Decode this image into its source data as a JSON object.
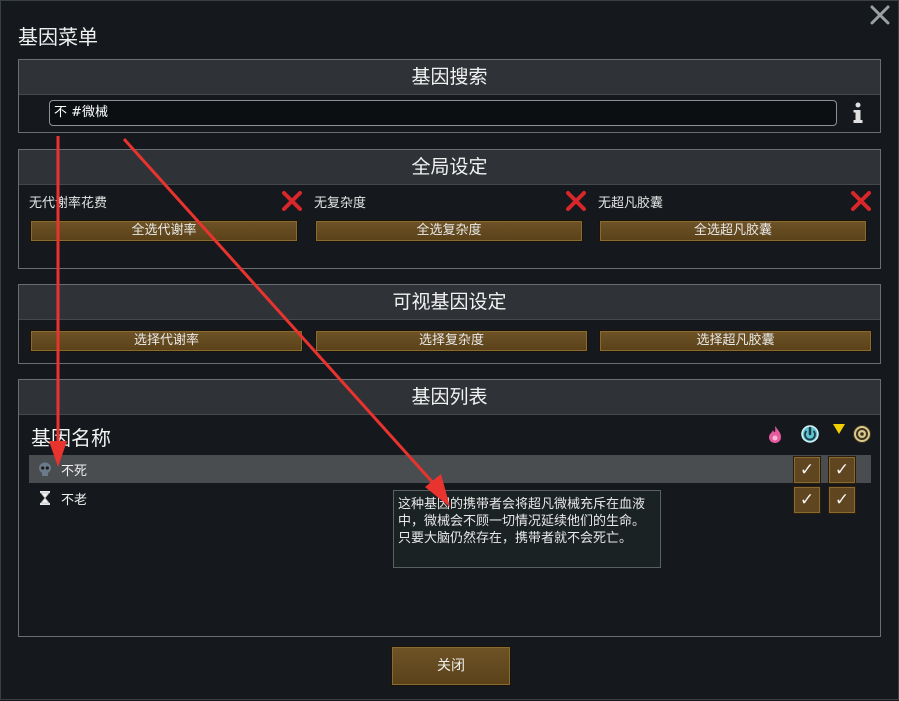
{
  "window": {
    "title": "基因菜单"
  },
  "search": {
    "header": "基因搜索",
    "value": "不 #微械"
  },
  "global": {
    "header": "全局设定",
    "options": [
      {
        "label": "无代谢率花费",
        "button": "全选代谢率"
      },
      {
        "label": "无复杂度",
        "button": "全选复杂度"
      },
      {
        "label": "无超凡胶囊",
        "button": "全选超凡胶囊"
      }
    ]
  },
  "visible": {
    "header": "可视基因设定",
    "buttons": [
      "选择代谢率",
      "选择复杂度",
      "选择超凡胶囊"
    ]
  },
  "genes": {
    "header": "基因列表",
    "name_column": "基因名称",
    "rows": [
      {
        "label": "不死",
        "icon": "skull-icon"
      },
      {
        "label": "不老",
        "icon": "hourglass-icon"
      }
    ],
    "check_glyph": "✓"
  },
  "tooltip": {
    "text": "这种基因的携带者会将超凡微械充斥在血液中，微械会不顾一切情况延续他们的生命。只要大脑仍然存在，携带者就不会死亡。"
  },
  "footer": {
    "close_label": "关闭"
  },
  "colors": {
    "accent_arrow": "#e8332f",
    "button": "#5f4620",
    "x_mark": "#d9262b"
  }
}
